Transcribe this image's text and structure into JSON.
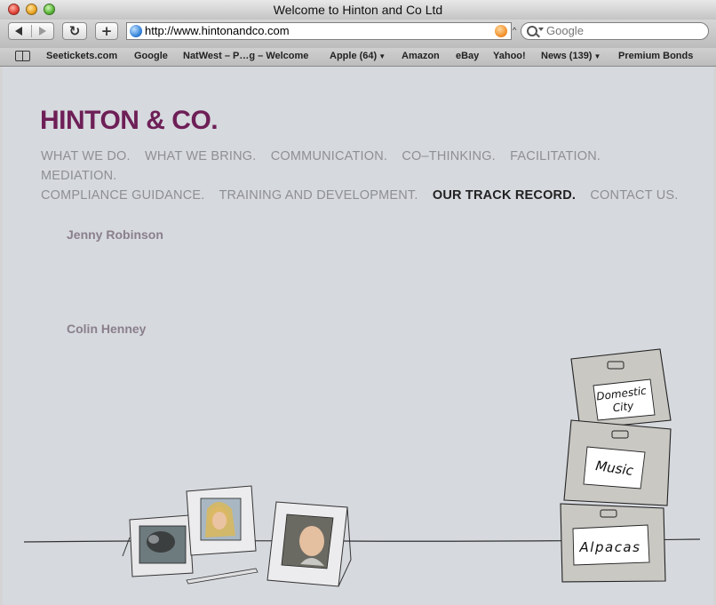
{
  "window": {
    "title": "Welcome to Hinton and Co Ltd"
  },
  "toolbar": {
    "url": "http://www.hintonandco.com",
    "search_placeholder": "Google",
    "reload_glyph": "↻",
    "add_glyph": "+"
  },
  "bookmarks": [
    {
      "label": "Seetickets.com",
      "dropdown": false
    },
    {
      "label": "Google",
      "dropdown": false
    },
    {
      "label": "NatWest – P…g – Welcome",
      "dropdown": false
    },
    {
      "label": "Apple (64)",
      "dropdown": true
    },
    {
      "label": "Amazon",
      "dropdown": false
    },
    {
      "label": "eBay",
      "dropdown": false
    },
    {
      "label": "Yahoo!",
      "dropdown": false
    },
    {
      "label": "News (139)",
      "dropdown": true
    },
    {
      "label": "Premium Bonds",
      "dropdown": false
    }
  ],
  "site": {
    "logo": "HINTON & CO.",
    "brand_color": "#6e1f57",
    "nav": [
      "WHAT WE DO.",
      "WHAT WE BRING.",
      "COMMUNICATION.",
      "CO–THINKING.",
      "FACILITATION.",
      "MEDIATION.",
      "COMPLIANCE GUIDANCE.",
      "TRAINING AND DEVELOPMENT.",
      "OUR TRACK RECORD.",
      "CONTACT US."
    ],
    "active_nav": "OUR TRACK RECORD.",
    "people": [
      "Jenny Robinson",
      "Colin Henney"
    ],
    "boxes": [
      {
        "label_line1": "Domestic",
        "label_line2": "City"
      },
      {
        "label_line1": "Music",
        "label_line2": ""
      },
      {
        "label_line1": "Alpacas",
        "label_line2": ""
      }
    ]
  }
}
